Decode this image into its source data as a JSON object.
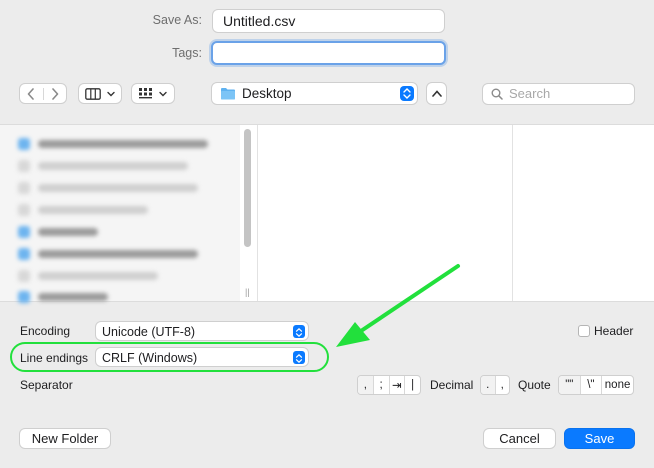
{
  "save": {
    "save_as_label": "Save As:",
    "filename": "Untitled.csv",
    "tags_label": "Tags:",
    "tags_value": ""
  },
  "toolbar": {
    "location": "Desktop",
    "search_placeholder": "Search"
  },
  "options": {
    "encoding_label": "Encoding",
    "encoding_value": "Unicode (UTF-8)",
    "header_label": "Header",
    "header_checked": false,
    "line_endings_label": "Line endings",
    "line_endings_value": "CRLF (Windows)",
    "separator_label": "Separator",
    "separator_options": [
      ",",
      ";",
      "⇥",
      "|"
    ],
    "decimal_label": "Decimal",
    "decimal_options": [
      ".",
      ","
    ],
    "quote_label": "Quote",
    "quote_options": [
      "\"\"",
      "\\\"",
      "none"
    ]
  },
  "buttons": {
    "new_folder": "New Folder",
    "cancel": "Cancel",
    "save": "Save"
  },
  "colors": {
    "accent": "#0a7aff",
    "annotation": "#22e03c"
  }
}
